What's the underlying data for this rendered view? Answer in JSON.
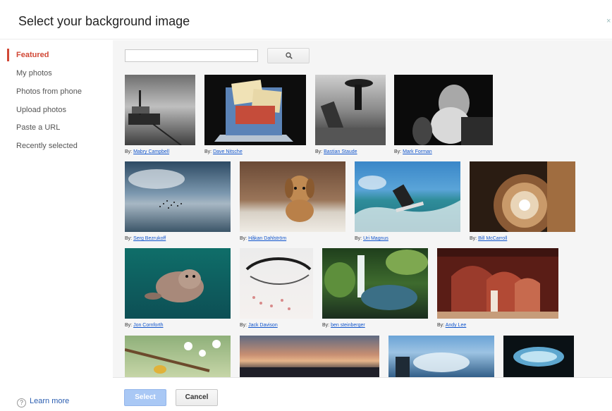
{
  "dialog": {
    "title": "Select your background image",
    "close_label": "×"
  },
  "sidebar": {
    "items": [
      {
        "label": "Featured",
        "active": true
      },
      {
        "label": "My photos",
        "active": false
      },
      {
        "label": "Photos from phone",
        "active": false
      },
      {
        "label": "Upload photos",
        "active": false
      },
      {
        "label": "Paste a URL",
        "active": false
      },
      {
        "label": "Recently selected",
        "active": false
      }
    ],
    "learn_more": "Learn more",
    "help_icon_glyph": "?"
  },
  "search": {
    "value": "",
    "placeholder": ""
  },
  "credit_prefix": "By:",
  "photos": [
    {
      "author": "Mabry Campbell"
    },
    {
      "author": "Dave Nitsche"
    },
    {
      "author": "Bastian Staude"
    },
    {
      "author": "Mark Forman"
    },
    {
      "author": "Serg Bezrukoff"
    },
    {
      "author": "Håkan Dahlström"
    },
    {
      "author": "Uri Magnus"
    },
    {
      "author": "Bill McCarroll"
    },
    {
      "author": "Jon Cornforth"
    },
    {
      "author": "Jack Davison"
    },
    {
      "author": "ben steinberger"
    },
    {
      "author": "Andy Lee"
    },
    {
      "author": ""
    },
    {
      "author": ""
    },
    {
      "author": ""
    },
    {
      "author": ""
    }
  ],
  "footer": {
    "select_label": "Select",
    "cancel_label": "Cancel"
  },
  "colors": {
    "accent": "#d14836",
    "link": "#1155cc",
    "primary_button_disabled": "#a9c8f5"
  }
}
